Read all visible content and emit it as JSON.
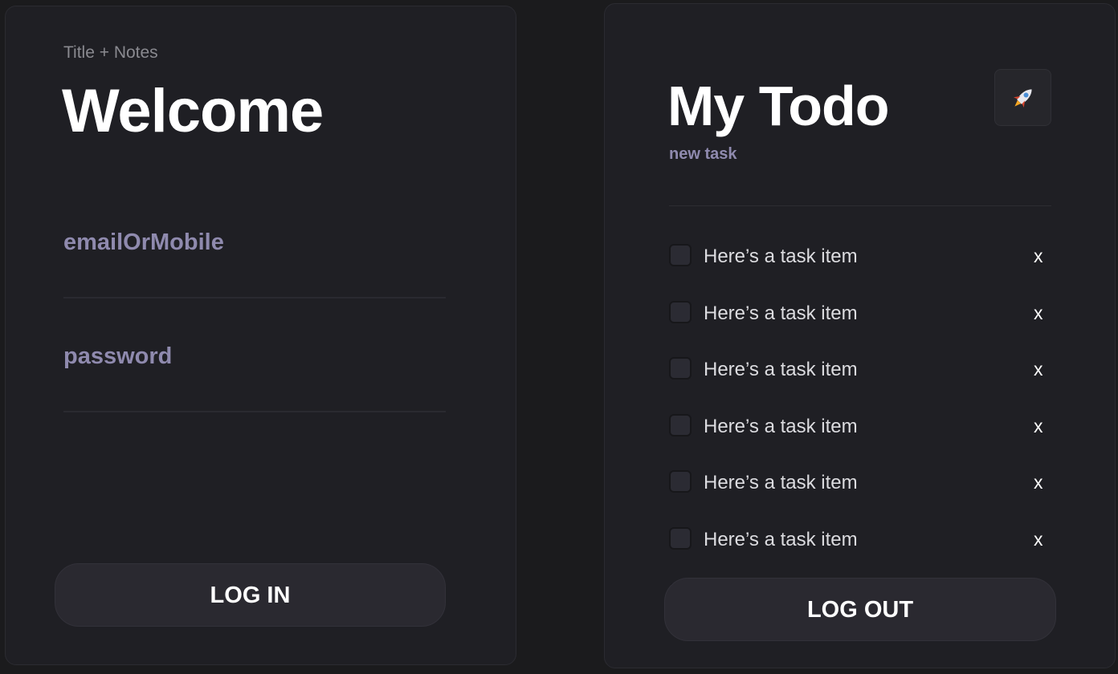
{
  "login": {
    "subtitle": "Title + Notes",
    "title": "Welcome",
    "email_placeholder": "emailOrMobile",
    "email_value": "",
    "password_placeholder": "password",
    "password_value": "",
    "login_label": "LOG IN"
  },
  "todo": {
    "title": "My Todo",
    "action_icon": "rocket-icon",
    "new_task_placeholder": "new task",
    "new_task_value": "",
    "tasks": [
      {
        "text": "Here’s a task item",
        "delete": "x",
        "checked": false
      },
      {
        "text": "Here’s a task item",
        "delete": "x",
        "checked": false
      },
      {
        "text": "Here’s a task item",
        "delete": "x",
        "checked": false
      },
      {
        "text": "Here’s a task item",
        "delete": "x",
        "checked": false
      },
      {
        "text": "Here’s a task item",
        "delete": "x",
        "checked": false
      },
      {
        "text": "Here’s a task item",
        "delete": "x",
        "checked": false
      },
      {
        "text": "",
        "delete": "",
        "checked": false
      }
    ],
    "logout_label": "LOG OUT"
  },
  "colors": {
    "page_background": "#1b1b1d",
    "card_background": "#1f1f24",
    "placeholder": "#8f8aae",
    "button_background": "#2a2930",
    "text_primary": "#ffffff"
  }
}
